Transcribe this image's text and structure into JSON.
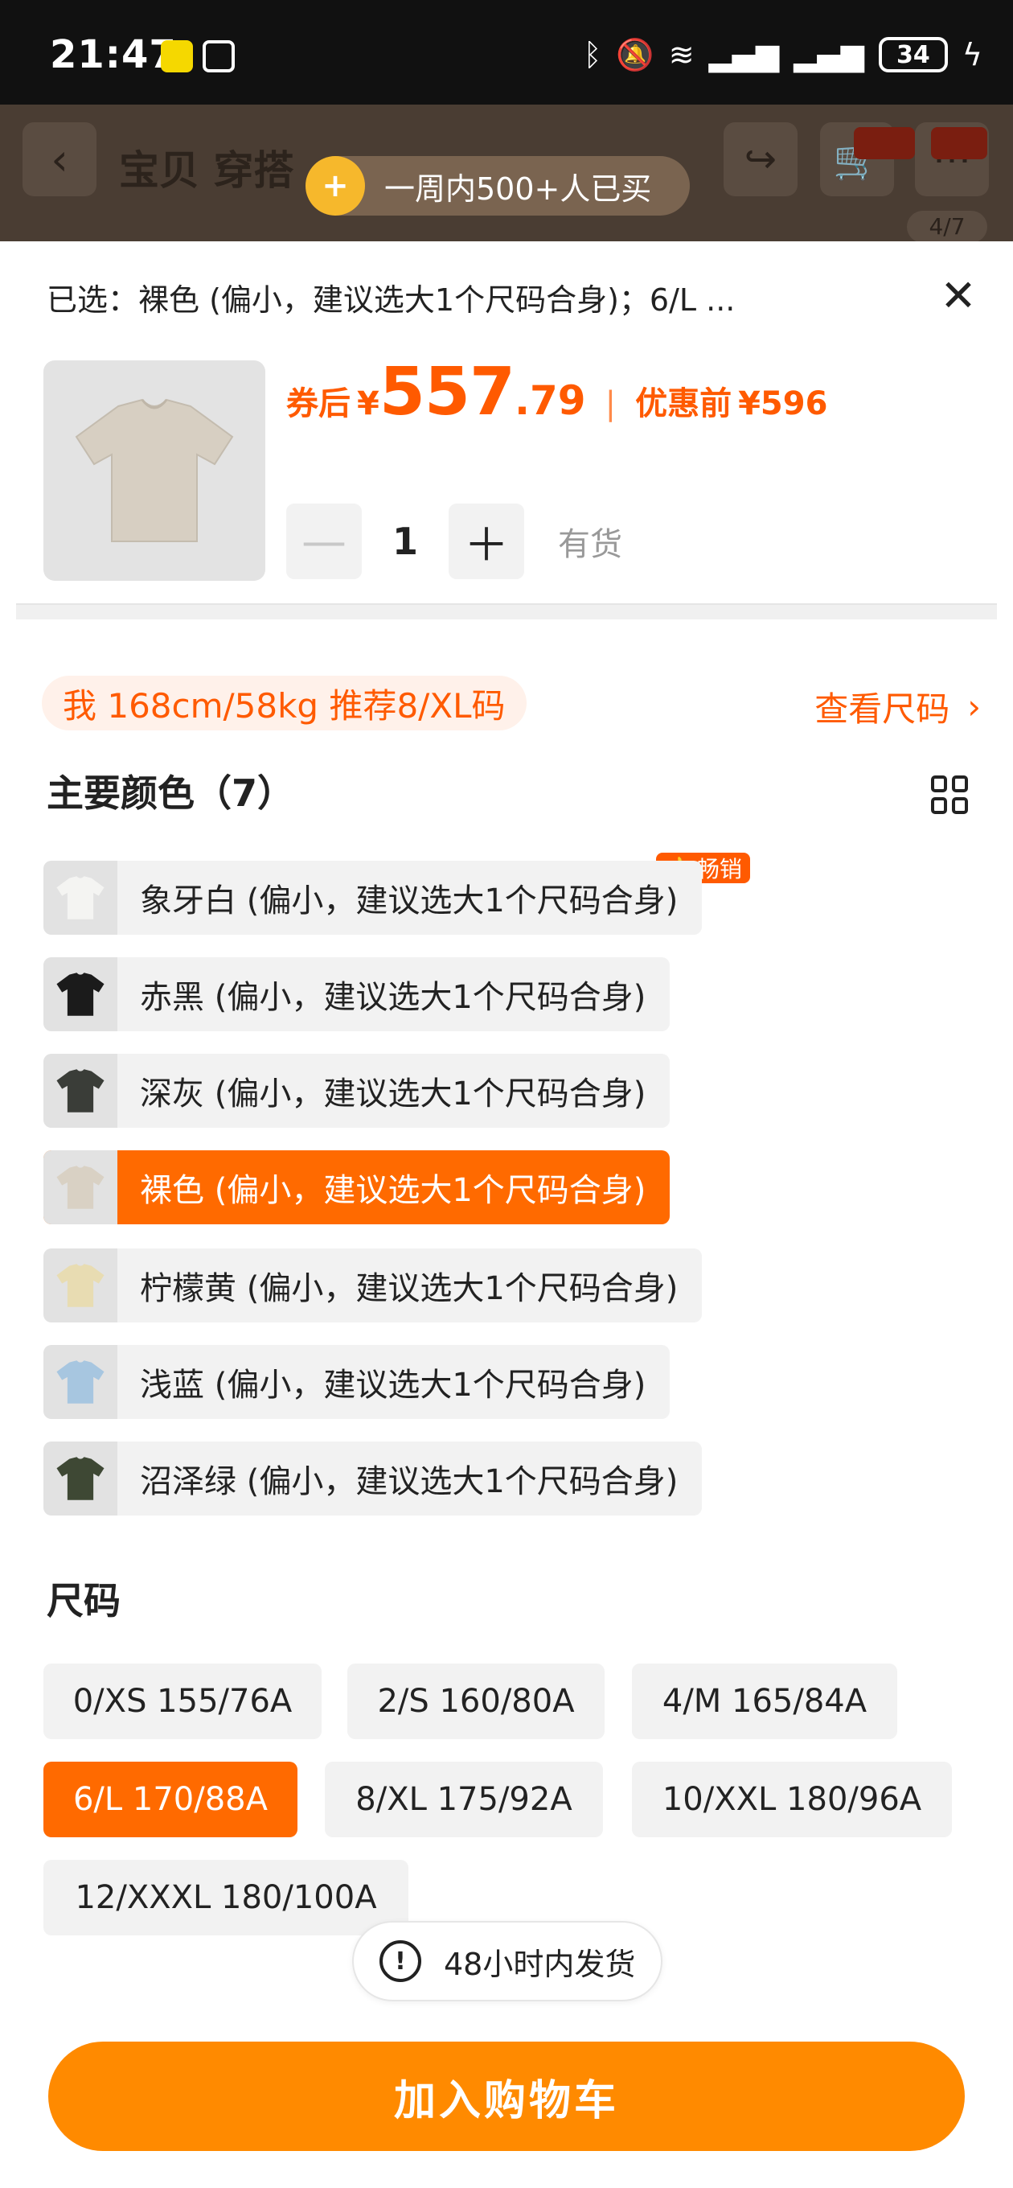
{
  "status_bar": {
    "time": "21:47",
    "battery": "34",
    "icons": [
      "bluetooth-icon",
      "mute-icon",
      "wifi-icon",
      "signal-icon",
      "signal-icon",
      "charging-icon"
    ]
  },
  "background_page": {
    "tabs": "宝贝 穿搭",
    "image_counter": "4/7"
  },
  "social_proof": {
    "text": "一周内500+人已买"
  },
  "sheet": {
    "selected_summary": "已选：裸色 (偏小，建议选大1个尺码合身)；6/L ...",
    "price": {
      "after_coupon_label": "券后",
      "currency": "¥",
      "integer": "557",
      "decimal": ".79",
      "separator": "|",
      "before_label": "优惠前",
      "before_value": "¥596"
    },
    "quantity": {
      "minus": "—",
      "value": "1",
      "plus": "＋",
      "stock_status": "有货"
    },
    "recommendation": "我 168cm/58kg 推荐8/XL码",
    "size_chart_link": "查看尺码",
    "colors_title": "主要颜色（7）",
    "hot_badge": "畅销",
    "colors": [
      {
        "label": "象牙白 (偏小，建议选大1个尺码合身)",
        "swatch": "#f4f4f2"
      },
      {
        "label": "赤黑 (偏小，建议选大1个尺码合身)",
        "swatch": "#1b1b1b"
      },
      {
        "label": "深灰 (偏小，建议选大1个尺码合身)",
        "swatch": "#3a3d38"
      },
      {
        "label": "裸色 (偏小，建议选大1个尺码合身)",
        "swatch": "#d9d1c4"
      },
      {
        "label": "柠檬黄 (偏小，建议选大1个尺码合身)",
        "swatch": "#e8dcb2"
      },
      {
        "label": "浅蓝 (偏小，建议选大1个尺码合身)",
        "swatch": "#a7c6e0"
      },
      {
        "label": "沼泽绿 (偏小，建议选大1个尺码合身)",
        "swatch": "#3e4834"
      }
    ],
    "sizes_title": "尺码",
    "sizes": [
      "0/XS 155/76A",
      "2/S 160/80A",
      "4/M 165/84A",
      "6/L 170/88A",
      "8/XL 175/92A",
      "10/XXL 180/96A",
      "12/XXXL 180/100A"
    ],
    "shipping_notice": "48小时内发货",
    "add_to_cart": "加入购物车"
  },
  "colors": {
    "accent": "#ff5a00",
    "selected_fill": "#ff6a00",
    "cart_button": "#ff8a00"
  }
}
